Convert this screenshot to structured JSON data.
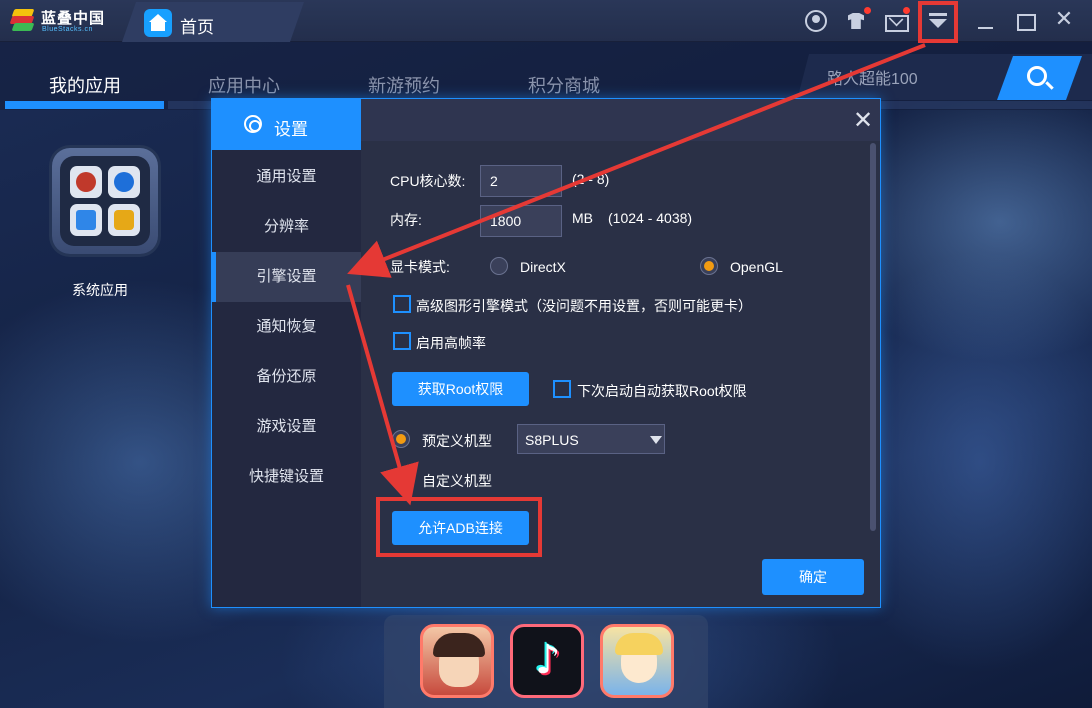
{
  "app": {
    "logo_cn": "蓝叠中国",
    "logo_en": "BlueStacks.cn",
    "home_tab_label": "首页"
  },
  "titlebar": {
    "icons": [
      "user-icon",
      "shirt-icon",
      "mail-icon",
      "menu-dropdown-icon",
      "minimize-icon",
      "maximize-icon",
      "close-icon"
    ],
    "notification_color": "#ff3b30"
  },
  "nav": {
    "items": [
      {
        "label": "我的应用",
        "active": true
      },
      {
        "label": "应用中心",
        "active": false
      },
      {
        "label": "新游预约",
        "active": false
      },
      {
        "label": "积分商城",
        "active": false
      }
    ],
    "search_value": "路人超能100"
  },
  "desktop": {
    "system_apps_label": "系统应用"
  },
  "dialog": {
    "title": "设置",
    "sidebar": [
      {
        "label": "通用设置",
        "active": false
      },
      {
        "label": "分辨率",
        "active": false
      },
      {
        "label": "引擎设置",
        "active": true
      },
      {
        "label": "通知恢复",
        "active": false
      },
      {
        "label": "备份还原",
        "active": false
      },
      {
        "label": "游戏设置",
        "active": false
      },
      {
        "label": "快捷键设置",
        "active": false
      }
    ],
    "cpu_label": "CPU核心数:",
    "cpu_value": "2",
    "cpu_range": "(2 - 8)",
    "memory_label": "内存:",
    "memory_value": "1800",
    "memory_unit": "MB",
    "memory_range": "(1024 - 4038)",
    "gpu_label": "显卡模式:",
    "gpu_options": [
      {
        "label": "DirectX",
        "selected": false
      },
      {
        "label": "OpenGL",
        "selected": true
      }
    ],
    "advanced_graphics_label": "高级图形引擎模式（没问题不用设置，否则可能更卡）",
    "advanced_graphics_checked": false,
    "high_fps_label": "启用高帧率",
    "high_fps_checked": false,
    "root_button": "获取Root权限",
    "auto_root_label": "下次启动自动获取Root权限",
    "auto_root_checked": false,
    "preset_model_label": "预定义机型",
    "preset_model_selected": true,
    "preset_model_value": "S8PLUS",
    "custom_model_label": "自定义机型",
    "custom_model_selected": false,
    "adb_button": "允许ADB连接",
    "confirm_button": "确定"
  },
  "colors": {
    "accent": "#1e90ff",
    "radio_selected": "#f29b12",
    "annotation_red": "#e53935"
  }
}
